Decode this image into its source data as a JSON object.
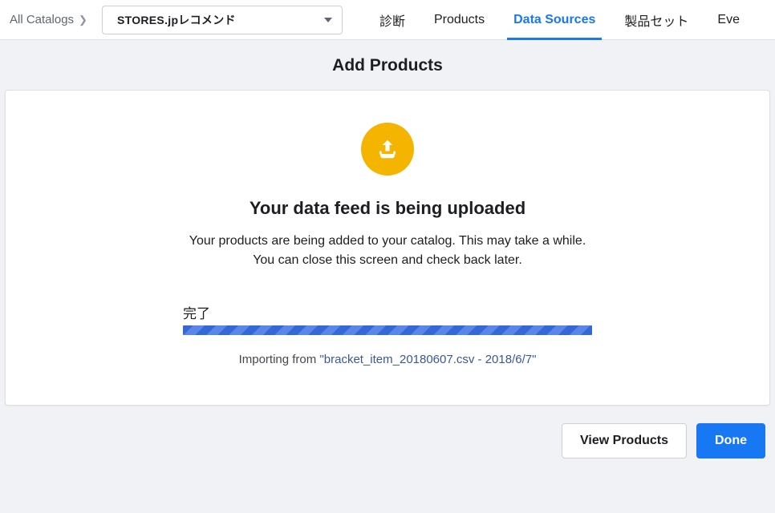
{
  "breadcrumb": {
    "all_catalogs": "All Catalogs"
  },
  "catalog_select": {
    "selected": "STORES.jpレコメンド"
  },
  "tabs": {
    "items": [
      {
        "label": "診断",
        "active": false
      },
      {
        "label": "Products",
        "active": false
      },
      {
        "label": "Data Sources",
        "active": true
      },
      {
        "label": "製品セット",
        "active": false
      },
      {
        "label": "Eve",
        "active": false
      }
    ]
  },
  "page": {
    "title": "Add Products"
  },
  "upload": {
    "heading": "Your data feed is being uploaded",
    "description": "Your products are being added to your catalog. This may take a while. You can close this screen and check back later.",
    "progress_label": "完了",
    "importing_prefix": "Importing from ",
    "importing_file": "\"bracket_item_20180607.csv - 2018/6/7\"",
    "progress_percent": 100
  },
  "footer": {
    "view_products": "View Products",
    "done": "Done"
  }
}
